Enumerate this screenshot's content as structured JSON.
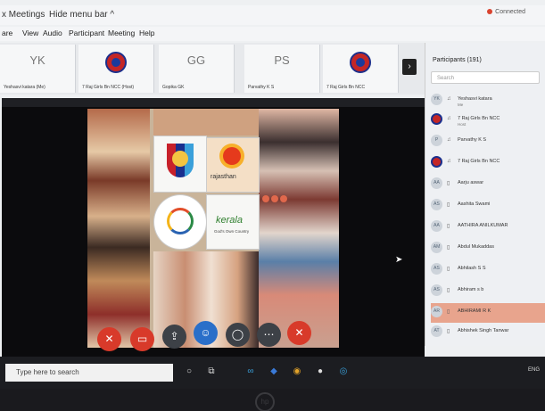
{
  "window": {
    "title": "x Meetings",
    "hide_menu": "Hide menu bar ^",
    "connection": "Connected"
  },
  "menu": [
    "are",
    "View",
    "Audio",
    "Participant",
    "Meeting",
    "Help"
  ],
  "thumbnails": [
    {
      "initials": "YK",
      "label": "Yeshasvi katara (Me)"
    },
    {
      "initials": "",
      "label": "7 Raj Girls Bn NCC (Host)"
    },
    {
      "initials": "GG",
      "label": "Gopika GK"
    },
    {
      "initials": "PS",
      "label": "Parvathy K S"
    },
    {
      "initials": "",
      "label": "7 Raj Girls Bn NCC"
    }
  ],
  "participants": {
    "header": "Participants (191)",
    "search_placeholder": "Search",
    "list": [
      {
        "initials": "YK",
        "name": "Yeshasvi katara",
        "sub": "Me"
      },
      {
        "initials": "",
        "name": "7 Raj Girls Bn NCC",
        "sub": "Host"
      },
      {
        "initials": "P",
        "name": "Parvathy K S",
        "sub": ""
      },
      {
        "initials": "",
        "name": "7 Raj Girls Bn NCC",
        "sub": ""
      },
      {
        "initials": "AA",
        "name": "Aarju aswar",
        "sub": ""
      },
      {
        "initials": "AS",
        "name": "Aashita Swami",
        "sub": ""
      },
      {
        "initials": "AA",
        "name": "AATHIRA ANILKUMAR",
        "sub": ""
      },
      {
        "initials": "AM",
        "name": "Abdul Mukaddas",
        "sub": ""
      },
      {
        "initials": "AS",
        "name": "Abhilash S S",
        "sub": ""
      },
      {
        "initials": "AS",
        "name": "Abhiram s b",
        "sub": ""
      },
      {
        "initials": "AR",
        "name": "ABHIRAMI R K",
        "sub": ""
      },
      {
        "initials": "AT",
        "name": "Abhishek Singh Tanwar",
        "sub": ""
      }
    ]
  },
  "main": {
    "logos": {
      "rajasthan": "rajasthan",
      "kerala": "kerala",
      "kerala_sub": "God's Own Country"
    }
  },
  "taskbar": {
    "search_placeholder": "Type here to search",
    "lang": "ENG"
  },
  "brand": "hp"
}
